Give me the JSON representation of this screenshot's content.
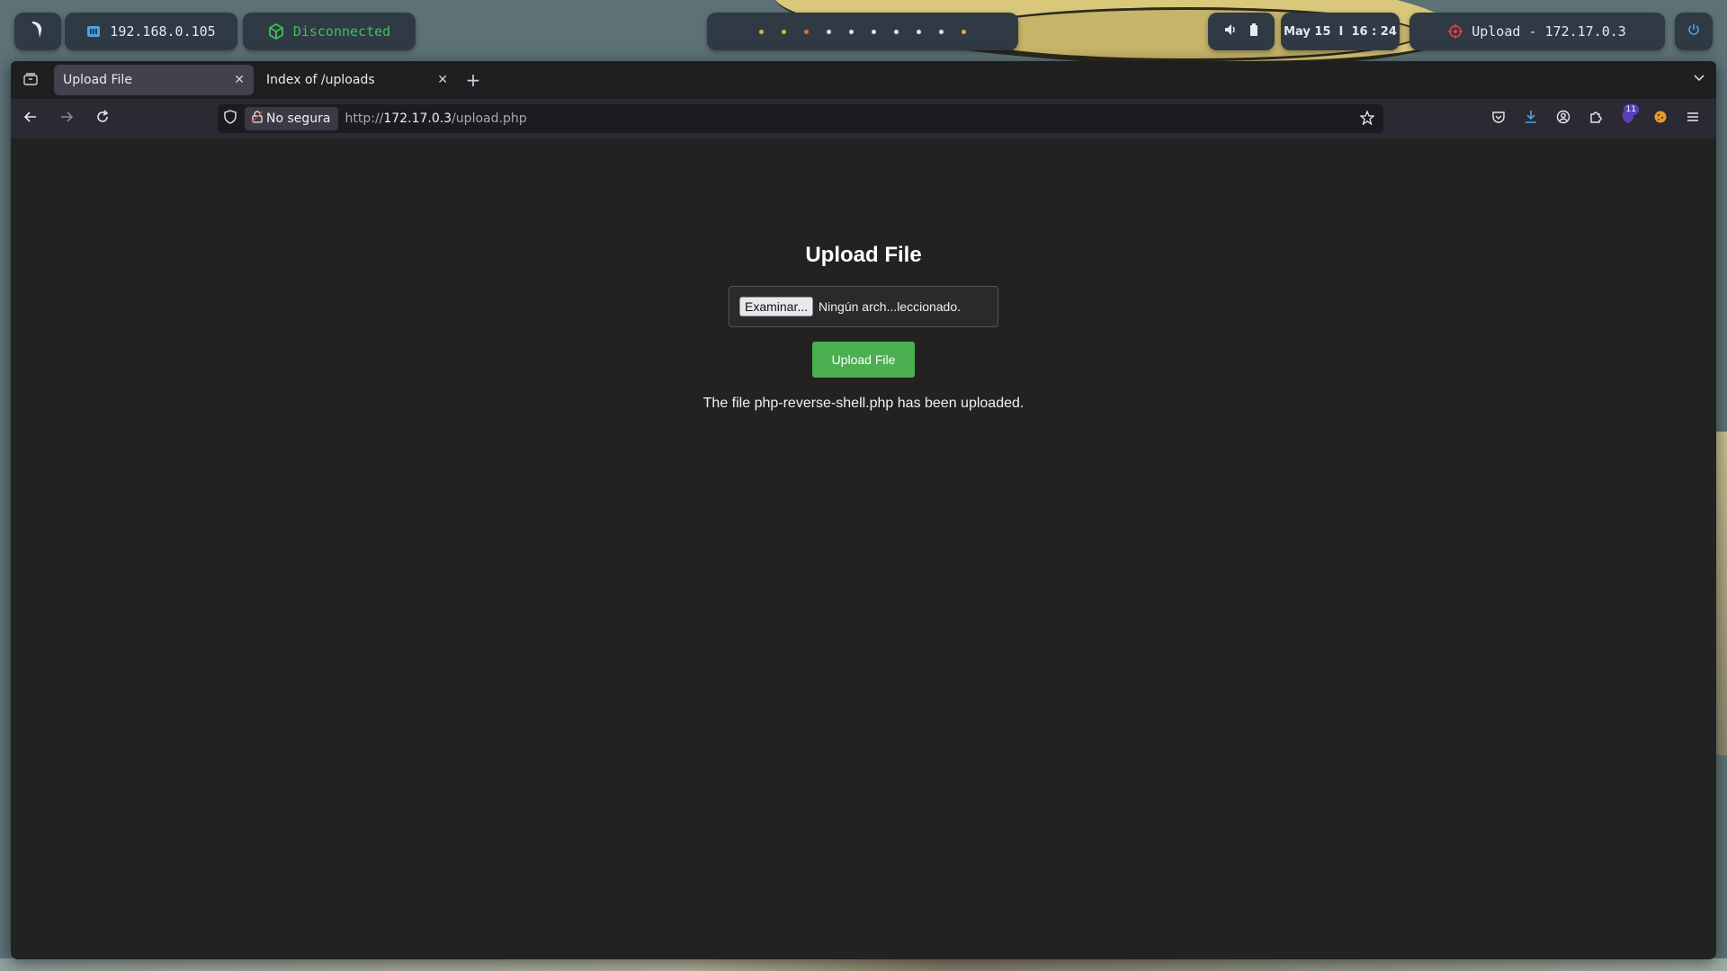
{
  "topbar": {
    "ip_address": "192.168.0.105",
    "vpn_status": "Disconnected",
    "workspace_dots": [
      "yellow",
      "yellow",
      "red",
      "white",
      "white",
      "white",
      "white",
      "white",
      "white",
      "yellow"
    ],
    "clock": "May 15  I  16 : 24",
    "target_label": "Upload - 172.17.0.3"
  },
  "tabs": [
    {
      "title": "Upload File",
      "active": true
    },
    {
      "title": "Index of /uploads",
      "active": false
    }
  ],
  "navbar": {
    "security_label": "No segura",
    "url_prefix": "http://",
    "url_host": "172.17.0.3",
    "url_path": "/upload.php",
    "extension_badge": "11"
  },
  "page": {
    "heading": "Upload File",
    "browse_label": "Examinar...",
    "file_status": "Ningún arch...leccionado.",
    "upload_button": "Upload File",
    "message": "The file php-reverse-shell.php has been uploaded."
  },
  "colors": {
    "upload_button": "#4caf50",
    "page_background": "#222222",
    "vpn_status": "#3fbf5a"
  }
}
